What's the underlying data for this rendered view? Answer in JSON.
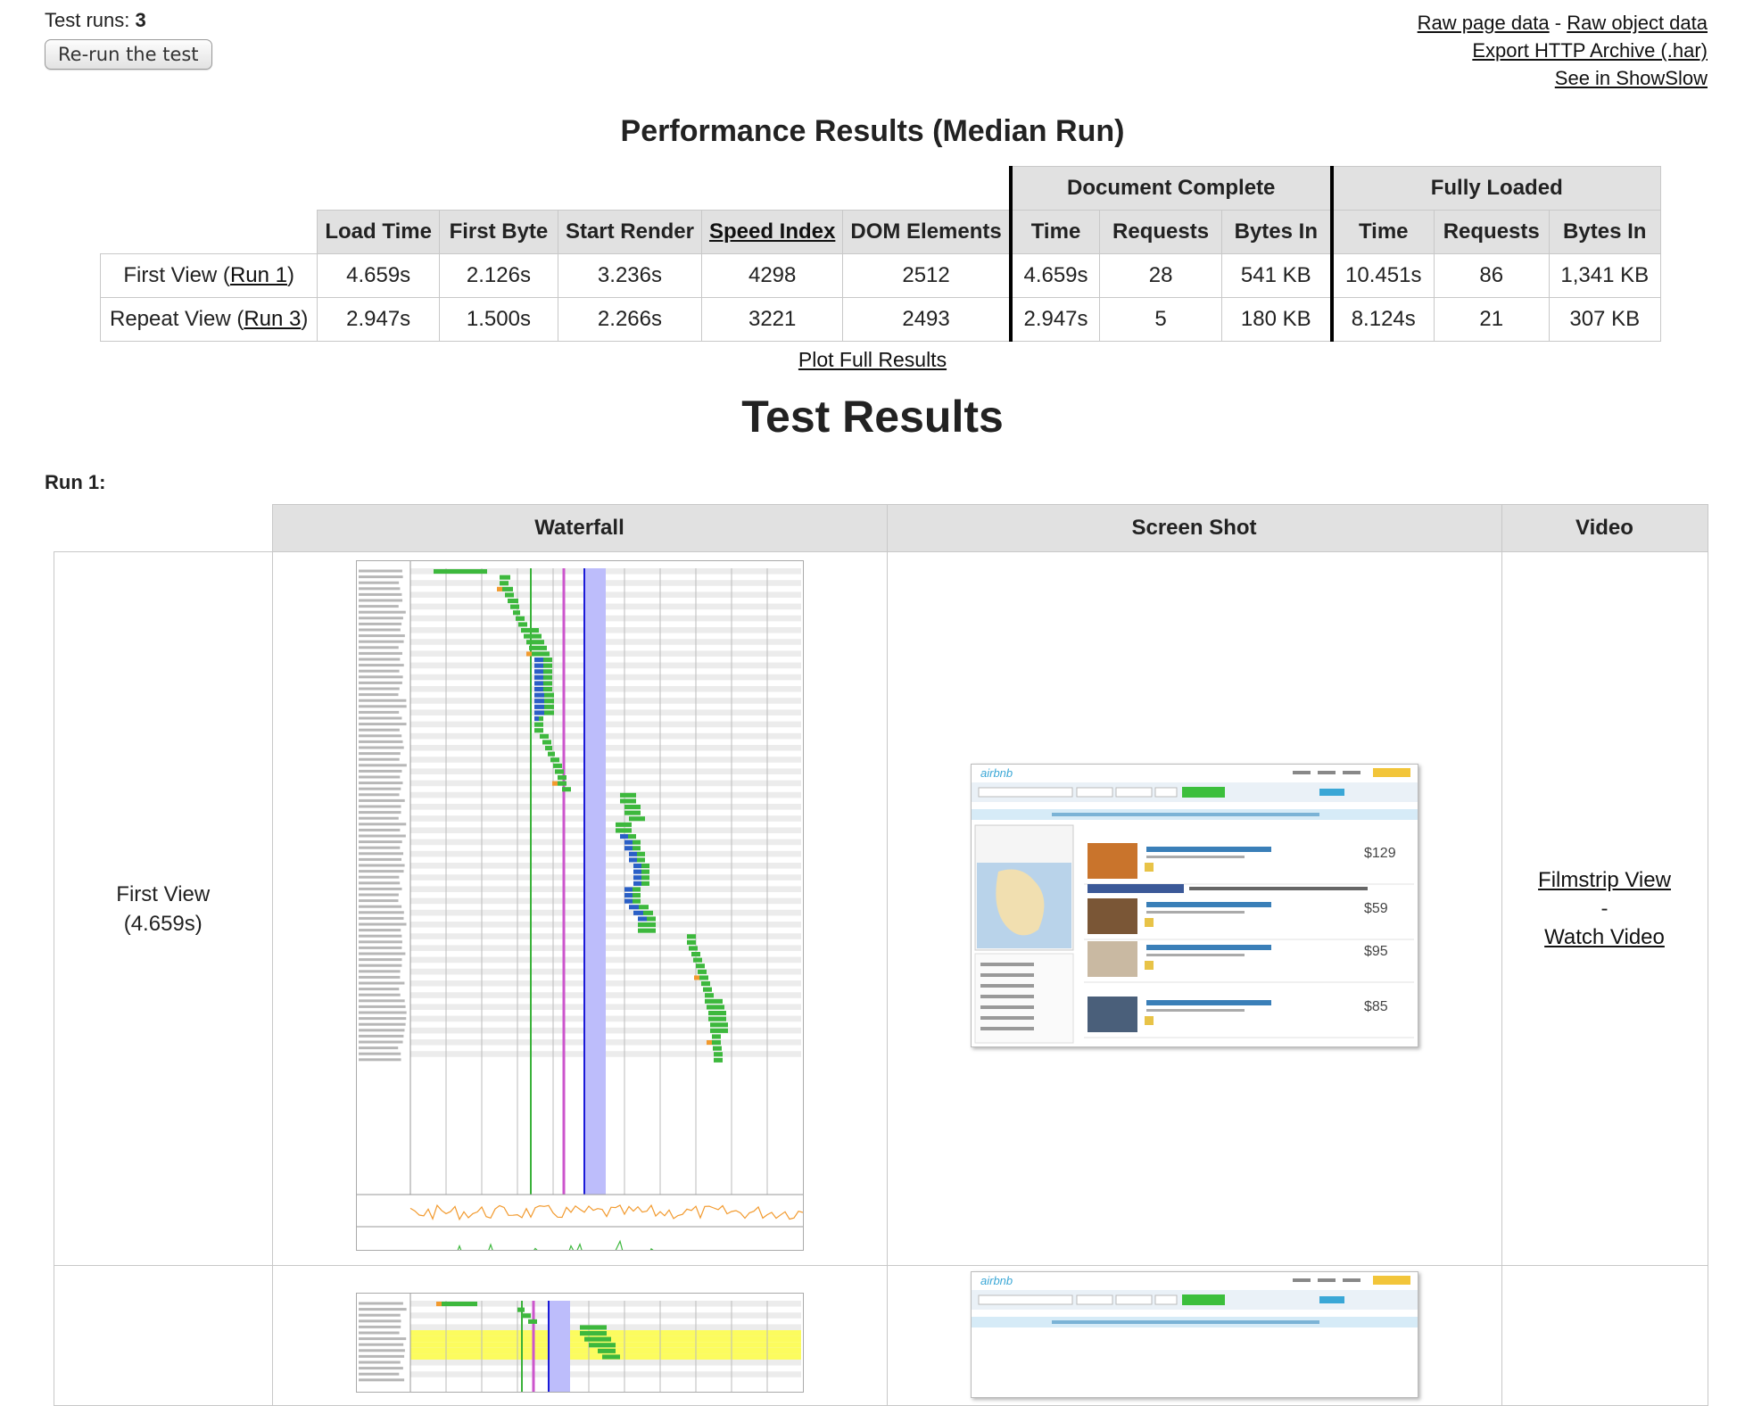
{
  "header": {
    "test_runs_label": "Test runs:",
    "test_runs_value": "3",
    "rerun_button": "Re-run the test",
    "links": {
      "raw_page_data": "Raw page data",
      "separator": "-",
      "raw_object_data": "Raw object data",
      "export_har": "Export HTTP Archive (.har)",
      "showslow": "See in ShowSlow"
    }
  },
  "performance": {
    "title": "Performance Results (Median Run)",
    "group_headers": {
      "document_complete": "Document Complete",
      "fully_loaded": "Fully Loaded"
    },
    "columns": [
      "Load Time",
      "First Byte",
      "Start Render",
      "Speed Index",
      "DOM Elements",
      "Time",
      "Requests",
      "Bytes In",
      "Time",
      "Requests",
      "Bytes In"
    ],
    "rows": [
      {
        "label": "First View (",
        "run_link": "Run 1",
        "label_end": ")",
        "values": [
          "4.659s",
          "2.126s",
          "3.236s",
          "4298",
          "2512",
          "4.659s",
          "28",
          "541 KB",
          "10.451s",
          "86",
          "1,341 KB"
        ]
      },
      {
        "label": "Repeat View (",
        "run_link": "Run 3",
        "label_end": ")",
        "values": [
          "2.947s",
          "1.500s",
          "2.266s",
          "3221",
          "2493",
          "2.947s",
          "5",
          "180 KB",
          "8.124s",
          "21",
          "307 KB"
        ]
      }
    ],
    "plot_full_results": "Plot Full Results"
  },
  "test_results": {
    "title": "Test Results",
    "run_label": "Run 1:",
    "columns": [
      "Waterfall",
      "Screen Shot",
      "Video"
    ],
    "rows": [
      {
        "label_line1": "First View",
        "label_line2": "(4.659s)",
        "filmstrip": "Filmstrip View",
        "separator": "-",
        "watch_video": "Watch Video",
        "screenshot_prices": [
          "$129",
          "$59",
          "$95",
          "$85"
        ]
      },
      {
        "screenshot_prices": []
      }
    ]
  },
  "colors": {
    "header_bg": "#e1e1e1",
    "dns": "#1c8a6a",
    "connect": "#f29a2e",
    "ttfb": "#3db83d",
    "download": "#2a5fc6",
    "start_render": "#39b139",
    "dom_content": "#cc55cc",
    "doc_complete": "#1a1ad8",
    "onload_band": "#bdbdfb",
    "cpu": "#f29a2e",
    "bandwidth": "#3db83d",
    "cached_highlight": "#fcfc5e"
  }
}
